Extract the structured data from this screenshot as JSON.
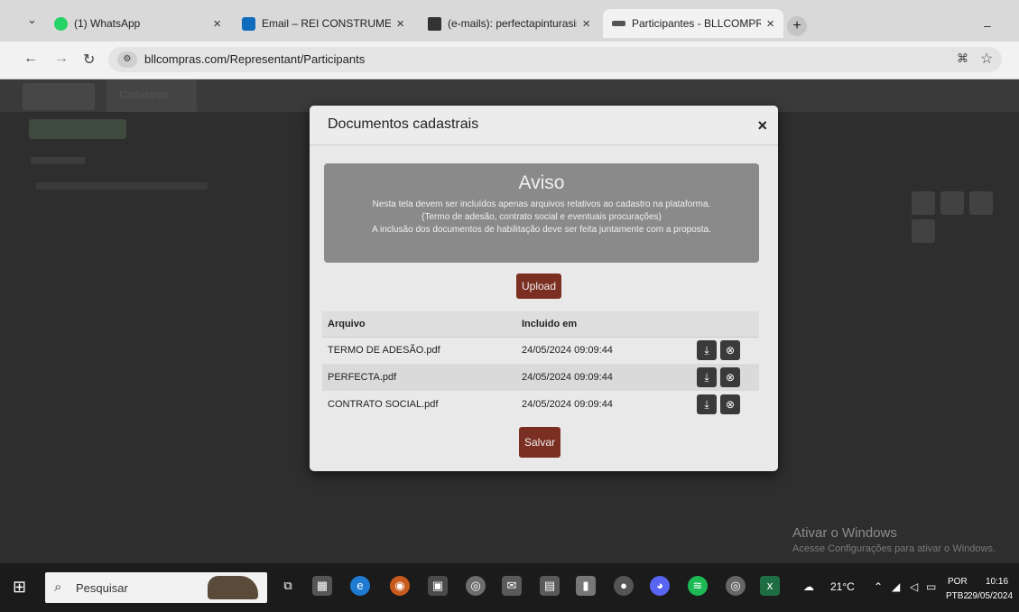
{
  "browser": {
    "tabs": [
      {
        "title": "(1) WhatsApp",
        "color": "#25D366"
      },
      {
        "title": "Email – REI CONSTRUMETAL – (",
        "color": "#0F6CBD"
      },
      {
        "title": "(e-mails): perfectapinturasind@",
        "color": "#333333"
      },
      {
        "title": "Participantes - BLLCOMPRAS",
        "color": "#555555",
        "active": true
      }
    ],
    "url": "bllcompras.com/Representant/Participants"
  },
  "page": {
    "menu": "Cadastros"
  },
  "modal": {
    "title": "Documentos cadastrais",
    "close": "×",
    "alert": {
      "title": "Aviso",
      "lines": [
        "Nesta tela devem ser incluídos apenas arquivos relativos ao cadastro na plataforma.",
        "(Termo de adesão, contrato social e eventuais procurações)",
        "A inclusão dos documentos de habilitação deve ser feita juntamente com a proposta."
      ]
    },
    "upload_label": "Upload",
    "table": {
      "headers": [
        "Arquivo",
        "Incluido em"
      ],
      "rows": [
        {
          "file": "TERMO DE ADESÃO.pdf",
          "date": "24/05/2024 09:09:44"
        },
        {
          "file": "PERFECTA.pdf",
          "date": "24/05/2024 09:09:44"
        },
        {
          "file": "CONTRATO SOCIAL.pdf",
          "date": "24/05/2024 09:09:44"
        }
      ]
    },
    "save_label": "Salvar"
  },
  "watermark": {
    "title": "Ativar o Windows",
    "subtitle": "Acesse Configurações para ativar o Windows."
  },
  "taskbar": {
    "search_placeholder": "Pesquisar",
    "weather": "21°C",
    "language": "POR",
    "keyboard": "PTB2",
    "time": "10:16",
    "date": "29/05/2024"
  }
}
